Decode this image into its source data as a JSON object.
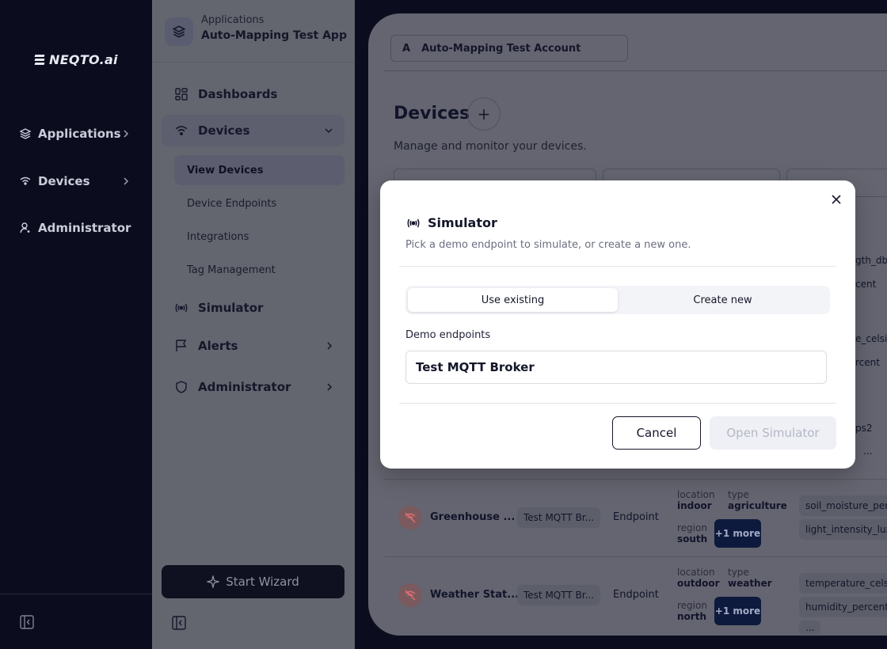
{
  "rail": {
    "logo_text": "NEQTO.ai",
    "items": [
      {
        "label": "Applications",
        "icon": "layers-icon"
      },
      {
        "label": "Devices",
        "icon": "wifi-icon"
      },
      {
        "label": "Administrator",
        "icon": "user-icon"
      }
    ]
  },
  "sidebar": {
    "app_kicker": "Applications",
    "app_name": "Auto-Mapping Test App",
    "nav": [
      {
        "label": "Dashboards",
        "icon": "grid-icon"
      },
      {
        "label": "Devices",
        "icon": "wifi-icon",
        "expanded": true
      },
      {
        "label": "Simulator",
        "icon": "broadcast-icon"
      },
      {
        "label": "Alerts",
        "icon": "flag-icon"
      },
      {
        "label": "Administrator",
        "icon": "shield-icon"
      }
    ],
    "subnav": [
      {
        "label": "View Devices",
        "active": true
      },
      {
        "label": "Device Endpoints"
      },
      {
        "label": "Integrations"
      },
      {
        "label": "Tag Management"
      }
    ],
    "wizard_label": "Start Wizard"
  },
  "main": {
    "account_initial": "A",
    "account_name": "Auto-Mapping Test Account",
    "title": "Devices",
    "add_label": "+",
    "subtitle": "Manage and monitor your devices.",
    "peek": {
      "t1": "gth_dbr",
      "t2": "cent",
      "t3": "e_celsius",
      "t4": "rcent",
      "t5": "ps2",
      "t6": "..."
    },
    "rows": [
      {
        "name": "Greenhouse ...",
        "endpoint": "Test MQTT Br...",
        "kind": "Endpoint",
        "tags": {
          "location_key": "location",
          "location_val": "indoor",
          "type_key": "type",
          "type_val": "agriculture",
          "region_key": "region",
          "region_val": "south"
        },
        "more": "+1 more",
        "metrics": [
          "soil_moisture_perce",
          "light_intensity_lux"
        ]
      },
      {
        "name": "Weather Stat...",
        "endpoint": "Test MQTT Br...",
        "kind": "Endpoint",
        "tags": {
          "location_key": "location",
          "location_val": "outdoor",
          "type_key": "type",
          "type_val": "weather",
          "region_key": "region",
          "region_val": "north"
        },
        "more": "+1 more",
        "metrics": [
          "temperature_celsius",
          "humidity_percent",
          "..."
        ]
      }
    ]
  },
  "modal": {
    "title": "Simulator",
    "description": "Pick a demo endpoint to simulate, or create a new one.",
    "tabs": [
      {
        "label": "Use existing",
        "active": true
      },
      {
        "label": "Create new",
        "active": false
      }
    ],
    "field_label": "Demo endpoints",
    "selected_endpoint": "Test MQTT Broker",
    "cancel_label": "Cancel",
    "open_label": "Open Simulator"
  }
}
